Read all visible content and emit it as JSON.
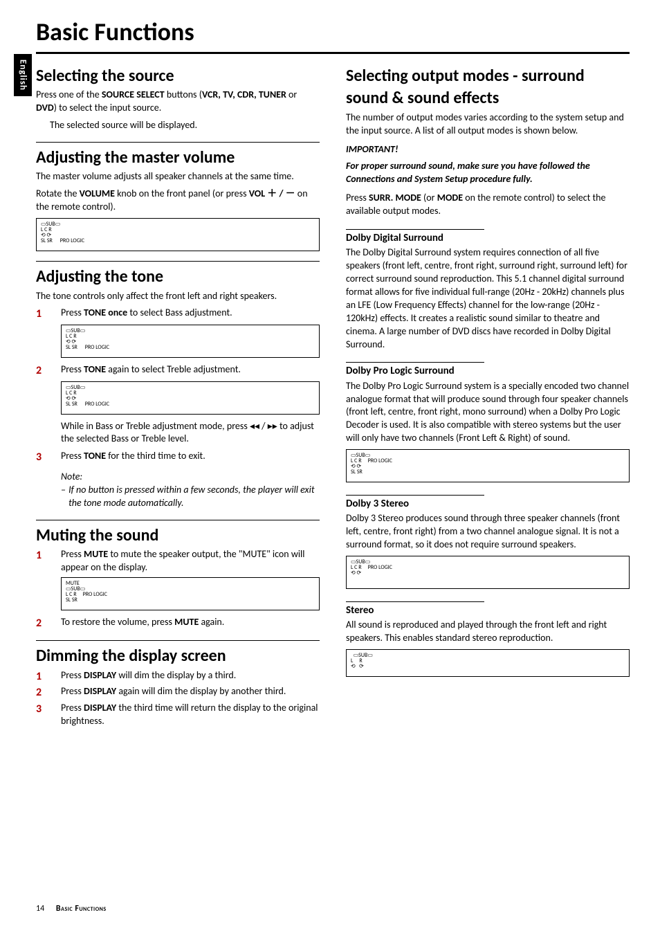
{
  "language_tab": "English",
  "title": "Basic Functions",
  "left": {
    "selecting_source": {
      "heading": "Selecting the source",
      "line1_pre": "Press one of the ",
      "line1_bold": "SOURCE SELECT",
      "line1_mid": " buttons (",
      "line1_opts": "VCR, TV, CDR, TUNER",
      "line1_or": " or ",
      "line1_dvd": "DVD",
      "line1_post": ") to select the input source.",
      "line2_arrow": "→",
      "line2": "The selected source will be displayed."
    },
    "master_volume": {
      "heading": "Adjusting the master volume",
      "p1": "The master volume adjusts all speaker channels at the same time.",
      "p2_pre": "Rotate the ",
      "p2_bold": "VOLUME",
      "p2_mid": " knob on the front panel (or press ",
      "p2_bold2": "VOL ＋ / －",
      "p2_post": " on the remote control)."
    },
    "tone": {
      "heading": "Adjusting the tone",
      "p1": "The tone controls only affect the front left and right speakers.",
      "step1_pre": "Press ",
      "step1_bold": "TONE once",
      "step1_post": " to select Bass adjustment.",
      "step2_pre": "Press ",
      "step2_bold": "TONE",
      "step2_post": " again to select Treble adjustment.",
      "after2": "While in Bass or Treble adjustment mode, press ◂◂ / ▸▸ to adjust the selected Bass or Treble level.",
      "step3_pre": "Press ",
      "step3_bold": "TONE",
      "step3_post": " for the third time to exit.",
      "note_label": "Note:",
      "note1": "If no button is pressed within a few seconds, the player will exit the tone mode automatically."
    },
    "mute": {
      "heading": "Muting the sound",
      "step1_pre": "Press ",
      "step1_bold": "MUTE",
      "step1_post": " to mute the speaker output, the \"MUTE\" icon will appear on the display.",
      "step2_pre": "To restore the volume, press ",
      "step2_bold": "MUTE",
      "step2_post": " again."
    },
    "dimming": {
      "heading": "Dimming the display screen",
      "step1_pre": "Press ",
      "step1_bold": "DISPLAY",
      "step1_post": " will dim the display by a third.",
      "step2_pre": "Press ",
      "step2_bold": "DISPLAY",
      "step2_post": " again will dim the display by another third.",
      "step3_pre": "Press ",
      "step3_bold": "DISPLAY",
      "step3_post": " the third time will return the display to the original brightness."
    }
  },
  "right": {
    "output_modes": {
      "heading": "Selecting output modes - surround sound & sound effects",
      "p1": "The number of output modes varies according to the system setup and the input source.  A list of all output modes is shown below.",
      "imp_label": "IMPORTANT!",
      "imp_text": "For proper surround sound, make sure you have followed the Connections and System Setup procedure fully.",
      "p2_pre": "Press ",
      "p2_bold": "SURR. MODE",
      "p2_mid": " (or ",
      "p2_bold2": "MODE",
      "p2_post": " on the remote control) to select the available output modes."
    },
    "dolby_digital": {
      "heading": "Dolby Digital Surround",
      "p": "The Dolby Digital Surround system requires connection of all five speakers (front left, centre, front right, surround right, surround left) for correct surround sound reproduction. This 5.1 channel digital surround format allows for five individual full-range (20Hz - 20kHz) channels plus an LFE (Low Frequency Effects) channel for the low-range (20Hz - 120kHz) effects.  It creates a realistic sound similar to theatre and cinema.  A large number of DVD discs have recorded in Dolby Digital Surround."
    },
    "dolby_prologic": {
      "heading": "Dolby Pro Logic Surround",
      "p": "The Dolby Pro Logic Surround system is a specially encoded two channel analogue format that will produce sound through four speaker channels (front left, centre, front right, mono surround) when a Dolby Pro Logic Decoder is used.  It is also compatible with stereo systems but the user will only have two channels (Front Left & Right) of sound."
    },
    "dolby3": {
      "heading": "Dolby 3 Stereo",
      "p": "Dolby 3 Stereo produces sound through three speaker channels (front left, centre, front right) from a two channel analogue signal.  It is not a surround format, so it does not require surround speakers."
    },
    "stereo": {
      "heading": "Stereo",
      "p": "All sound is reproduced and played through the front left and right speakers.  This enables standard stereo reproduction."
    }
  },
  "footer": {
    "page": "14",
    "label": "Basic Functions"
  }
}
